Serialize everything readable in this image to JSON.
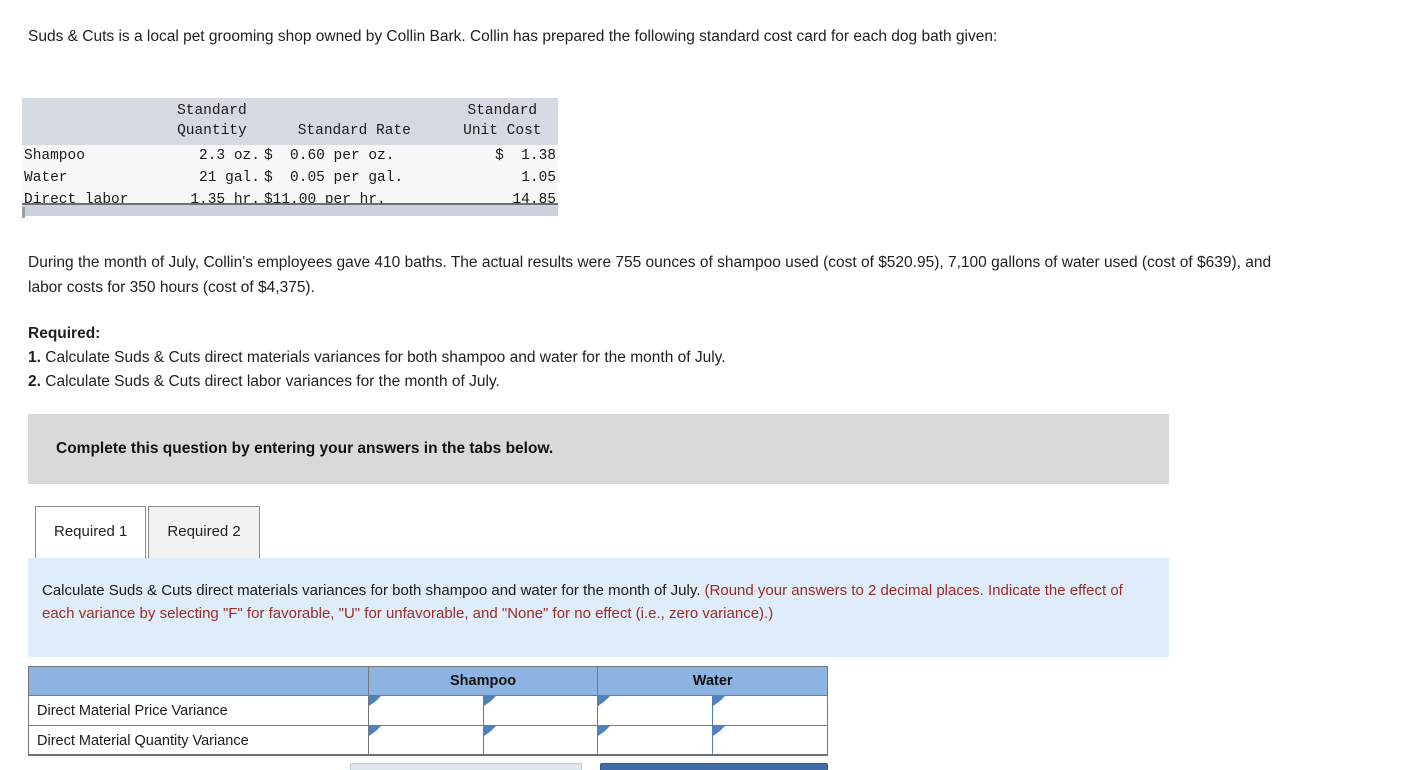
{
  "intro": {
    "text": "Suds & Cuts is a local pet grooming shop owned by Collin Bark. Collin has prepared the following standard cost card for each dog bath given:"
  },
  "cost_card": {
    "headers": {
      "blank": "",
      "quantity_line1": "Standard",
      "quantity_line2": "Quantity",
      "rate": "Standard Rate",
      "unit_cost_line1": "Standard",
      "unit_cost_line2": "Unit Cost"
    },
    "rows": [
      {
        "item": "Shampoo",
        "quantity": "2.3 oz.",
        "rate": "$  0.60 per oz.",
        "unit_cost": "$  1.38"
      },
      {
        "item": "Water",
        "quantity": " 21 gal.",
        "rate": "$  0.05 per gal.",
        "unit_cost": "1.05"
      },
      {
        "item": "Direct labor",
        "quantity": "1.35 hr.",
        "rate": "$11.00 per hr.",
        "unit_cost": "14.85"
      }
    ]
  },
  "actual_results": {
    "text": "During the month of July, Collin's employees gave 410 baths. The actual results were 755 ounces of shampoo used (cost of $520.95), 7,100 gallons of water used (cost of $639), and labor costs for 350 hours (cost of $4,375)."
  },
  "required": {
    "heading": "Required:",
    "items": [
      {
        "num": "1.",
        "text": "Calculate Suds & Cuts direct materials variances for both shampoo and water for the month of July."
      },
      {
        "num": "2.",
        "text": "Calculate Suds & Cuts direct labor variances for the month of July."
      }
    ]
  },
  "banner": {
    "text": "Complete this question by entering your answers in the tabs below."
  },
  "tabs": [
    {
      "label": "Required 1",
      "active": true
    },
    {
      "label": "Required 2",
      "active": false
    }
  ],
  "instruction": {
    "black_part": "Calculate Suds & Cuts direct materials variances for both shampoo and water for the month of July. ",
    "red_part": "(Round your answers to 2 decimal places. Indicate the effect of each variance by selecting \"F\" for favorable, \"U\" for unfavorable, and \"None\" for no effect (i.e., zero variance).)"
  },
  "answer_table": {
    "columns": [
      "",
      "Shampoo",
      "Water"
    ],
    "rows": [
      {
        "label": "Direct Material Price Variance",
        "shampoo_value": "",
        "shampoo_effect": "",
        "water_value": "",
        "water_effect": ""
      },
      {
        "label": "Direct Material Quantity Variance",
        "shampoo_value": "",
        "shampoo_effect": "",
        "water_value": "",
        "water_effect": ""
      }
    ]
  },
  "colors": {
    "header_blue": "#8db3e2",
    "instruction_bg": "#dfecf9",
    "instruction_red": "#9e2b25",
    "banner_gray": "#d9d9d9",
    "costcard_header": "#d5d9e1",
    "input_border": "#4f81bd",
    "next_button": "#3c6da8"
  },
  "footer_buttons": {
    "previous": "",
    "next": ""
  }
}
